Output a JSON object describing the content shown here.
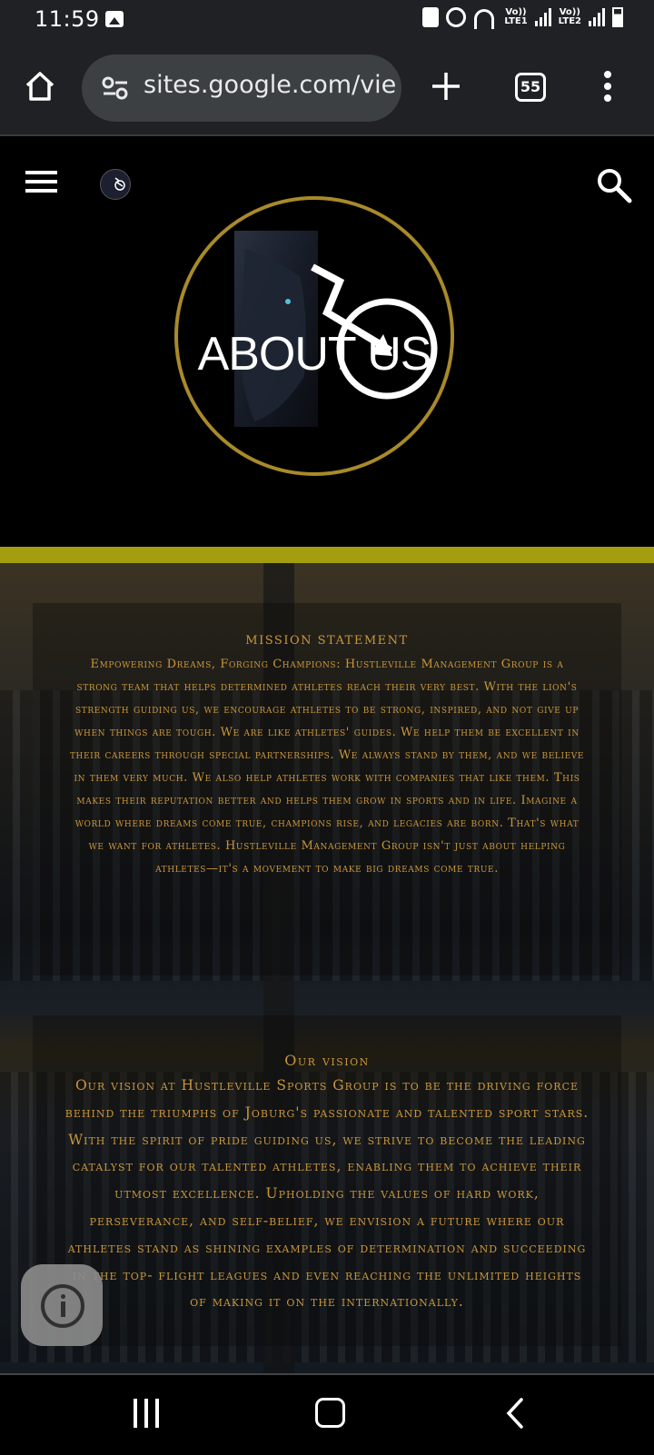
{
  "status_bar": {
    "time": "11:59",
    "lte1": "LTE1",
    "lte2": "LTE2",
    "vo": "Vo))"
  },
  "browser": {
    "url": "sites.google.com/vie",
    "tab_count": "55"
  },
  "site": {
    "hero_title": "ABOUT US"
  },
  "mission": {
    "heading": "MISSION STATEMENT",
    "body": "Empowering Dreams, Forging Champions: Hustleville Management Group is a strong team that helps determined athletes reach their very best. With the lion's strength guiding us, we encourage athletes to be strong, inspired, and not give up when things are tough. We are like athletes' guides. We help them be excellent in their careers through special partnerships. We always stand by them, and we believe in them very much. We also help athletes work with companies that like them. This makes their reputation better and helps them grow in sports and in life. Imagine a world where dreams come true, champions rise, and legacies are born. That's what we want for athletes. Hustleville Management Group isn't just about helping athletes—it's a movement to make big dreams come true."
  },
  "vision": {
    "heading": "Our vision",
    "body": "Our vision at Hustleville Sports Group is to be the driving force behind the triumphs of Joburg's passionate and talented sport stars. With the spirit of pride guiding us, we strive to become the leading catalyst for our talented athletes, enabling them to achieve their utmost excellence. Upholding the values of hard work, perseverance, and self-belief, we envision a future where our athletes stand as shining examples of determination and succeeding in the top- flight leagues and even reaching the unlimited heights of making it on the internationally."
  },
  "colors": {
    "gold_text": "#c9963a",
    "gold_strip": "#a39d10",
    "hero_ring": "#a88a2a"
  }
}
